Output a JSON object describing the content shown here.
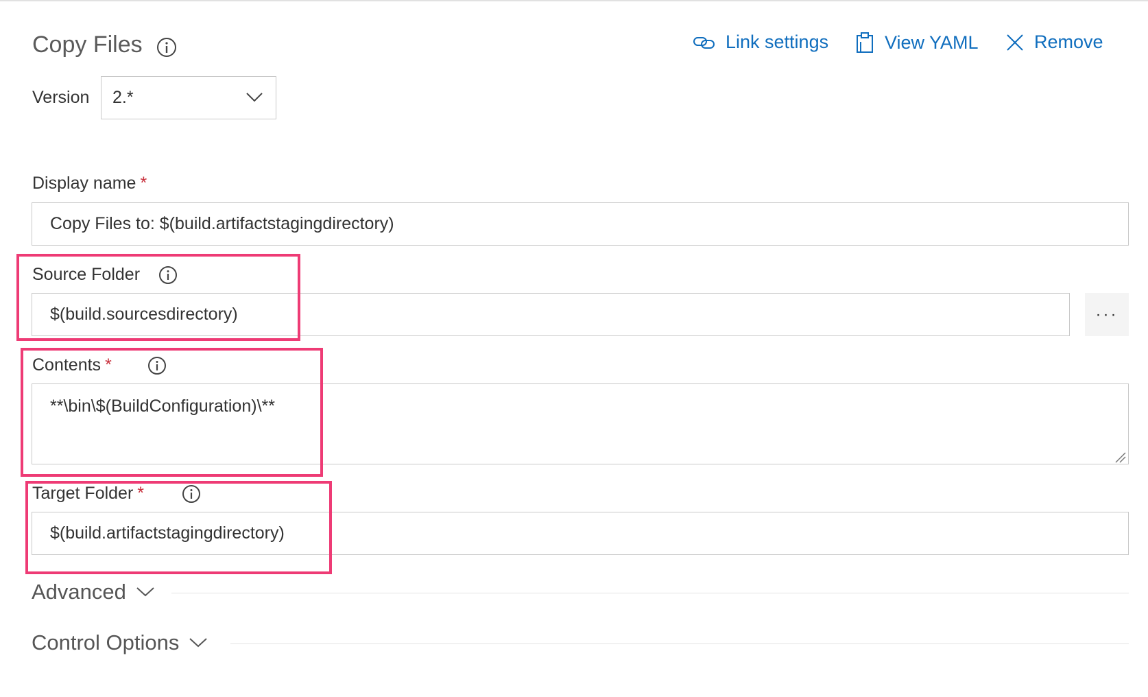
{
  "task": {
    "title": "Copy Files",
    "version_label": "Version",
    "version_value": "2.*"
  },
  "actions": {
    "link_settings": "Link settings",
    "view_yaml": "View YAML",
    "remove": "Remove"
  },
  "fields": {
    "display_name": {
      "label": "Display name",
      "required": "*",
      "value": "Copy Files to: $(build.artifactstagingdirectory)"
    },
    "source_folder": {
      "label": "Source Folder",
      "value": "$(build.sourcesdirectory)",
      "browse": "···"
    },
    "contents": {
      "label": "Contents",
      "required": "*",
      "value": "**\\bin\\$(BuildConfiguration)\\**"
    },
    "target_folder": {
      "label": "Target Folder",
      "required": "*",
      "value": "$(build.artifactstagingdirectory)"
    }
  },
  "sections": {
    "advanced": "Advanced",
    "control_options": "Control Options"
  },
  "colors": {
    "accent": "#106ebe",
    "highlight": "#ee3b75",
    "required": "#c8313d"
  }
}
